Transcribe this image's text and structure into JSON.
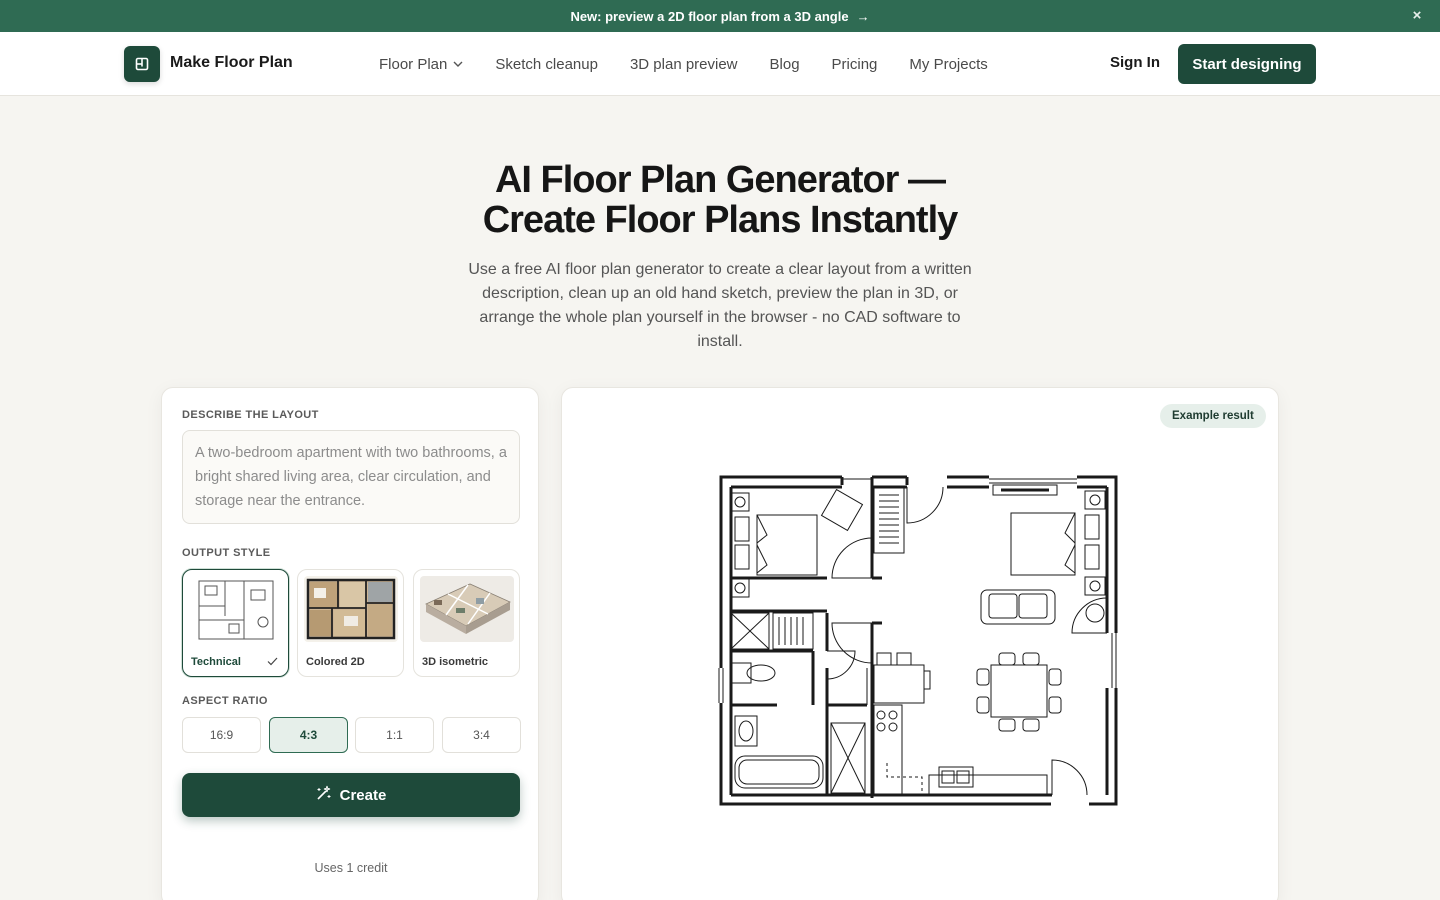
{
  "announcement": {
    "text": "New: preview a 2D floor plan from a 3D angle",
    "arrow": "→",
    "close": "×"
  },
  "nav": {
    "brand": "Make Floor Plan",
    "links": [
      {
        "label": "Floor Plan",
        "has_dropdown": true
      },
      {
        "label": "Sketch cleanup"
      },
      {
        "label": "3D plan preview"
      },
      {
        "label": "Blog"
      },
      {
        "label": "Pricing"
      },
      {
        "label": "My Projects"
      }
    ],
    "sign_in": "Sign In",
    "cta": "Start designing"
  },
  "hero": {
    "title_line1": "AI Floor Plan Generator —",
    "title_line2": "Create Floor Plans Instantly",
    "subtitle": "Use a free AI floor plan generator to create a clear layout from a written description, clean up an old hand sketch, preview the plan in 3D, or arrange the whole plan yourself in the browser - no CAD software to install."
  },
  "form": {
    "describe_label": "DESCRIBE THE LAYOUT",
    "describe_placeholder": "A two-bedroom apartment with two bathrooms, a bright shared living area, clear circulation, and storage near the entrance.",
    "output_label": "OUTPUT STYLE",
    "styles": [
      {
        "name": "Technical",
        "selected": true
      },
      {
        "name": "Colored 2D",
        "selected": false
      },
      {
        "name": "3D isometric",
        "selected": false
      }
    ],
    "aspect_label": "ASPECT RATIO",
    "ratios": [
      {
        "label": "16:9",
        "selected": false
      },
      {
        "label": "4:3",
        "selected": true
      },
      {
        "label": "1:1",
        "selected": false
      },
      {
        "label": "3:4",
        "selected": false
      }
    ],
    "create_label": "Create",
    "credit_text": "Uses 1 credit"
  },
  "preview": {
    "badge": "Example result",
    "image": "floor-plan-technical-drawing"
  },
  "colors": {
    "brand_dark": "#1e4a3a",
    "announce_bg": "#2f6b53",
    "page_bg": "#f6f5f1"
  }
}
